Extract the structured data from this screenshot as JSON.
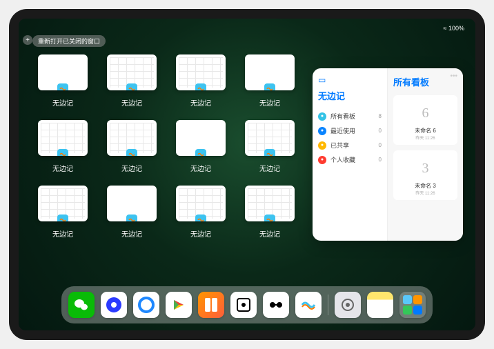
{
  "status": {
    "wifi": "≈",
    "battery": "100%"
  },
  "top_button": {
    "plus": "+",
    "reopen_label": "重新打开已关闭的窗口"
  },
  "app_windows": [
    {
      "label": "无边记",
      "type": "blank"
    },
    {
      "label": "无边记",
      "type": "grid"
    },
    {
      "label": "无边记",
      "type": "grid"
    },
    {
      "label": "无边记",
      "type": "blank"
    },
    {
      "label": "无边记",
      "type": "grid"
    },
    {
      "label": "无边记",
      "type": "grid"
    },
    {
      "label": "无边记",
      "type": "blank"
    },
    {
      "label": "无边记",
      "type": "grid"
    },
    {
      "label": "无边记",
      "type": "grid"
    },
    {
      "label": "无边记",
      "type": "blank"
    },
    {
      "label": "无边记",
      "type": "grid"
    },
    {
      "label": "无边记",
      "type": "grid"
    }
  ],
  "panel": {
    "left_title": "无边记",
    "right_title": "所有看板",
    "items": [
      {
        "icon_color": "#34c3e6",
        "label": "所有看板",
        "count": "8"
      },
      {
        "icon_color": "#0a84ff",
        "label": "最近使用",
        "count": "0"
      },
      {
        "icon_color": "#ffb800",
        "label": "已共享",
        "count": "0"
      },
      {
        "icon_color": "#ff3b30",
        "label": "个人收藏",
        "count": "0"
      }
    ],
    "boards": [
      {
        "sketch": "6",
        "name": "未命名 6",
        "date": "昨天 11:26"
      },
      {
        "sketch": "3",
        "name": "未命名 3",
        "date": "昨天 11:26"
      }
    ]
  },
  "dock": [
    {
      "name": "wechat",
      "bg": "#09bb07",
      "glyph": "●●"
    },
    {
      "name": "quark",
      "bg": "#ffffff",
      "glyph": "◉"
    },
    {
      "name": "browser",
      "bg": "#ffffff",
      "glyph": "◯"
    },
    {
      "name": "video",
      "bg": "#ffffff",
      "glyph": "▶"
    },
    {
      "name": "books",
      "bg": "linear-gradient(135deg,#ff9500,#ff5e3a)",
      "glyph": "▮▮"
    },
    {
      "name": "dice",
      "bg": "#ffffff",
      "glyph": "⊡"
    },
    {
      "name": "linked",
      "bg": "#ffffff",
      "glyph": "⋈"
    },
    {
      "name": "freeform",
      "bg": "#ffffff",
      "glyph": "〰"
    },
    {
      "name": "settings",
      "bg": "#e5e5ea",
      "glyph": "⚙"
    },
    {
      "name": "notes",
      "bg": "linear-gradient(#ffe66d 30%,#fff 30%)",
      "glyph": ""
    },
    {
      "name": "app-library",
      "bg": "rgba(255,255,255,0.2)",
      "glyph": "⊞"
    }
  ]
}
